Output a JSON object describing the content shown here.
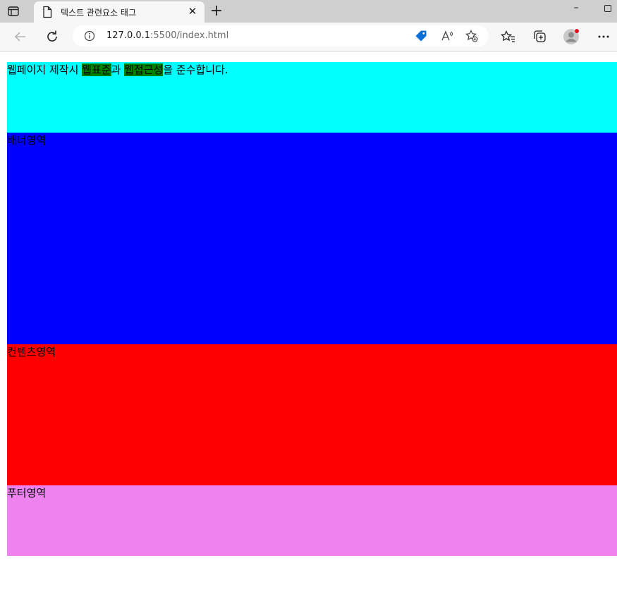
{
  "browser": {
    "tab_title": "텍스트 관련요소 태그",
    "url_host": "127.0.0.1",
    "url_rest": ":5500/index.html"
  },
  "page": {
    "header": {
      "text_1": "웹페이지 제작시 ",
      "highlight_1": "웹표준",
      "text_2": "과 ",
      "highlight_2": "웹접근성",
      "text_3": "을 준수합니다.",
      "bg": "#00ffff"
    },
    "banner": {
      "label": "배너영역",
      "bg": "#0000ff"
    },
    "content": {
      "label": "컨텐츠영역",
      "bg": "#ff0000"
    },
    "footer": {
      "label": "푸터영역",
      "bg": "#ee82ee"
    },
    "highlight_color": "#008000"
  },
  "icons": [
    "tab-actions-icon",
    "page-icon",
    "close-icon",
    "plus-icon",
    "minimize-icon",
    "maximize-icon",
    "back-icon",
    "refresh-icon",
    "info-icon",
    "tag-icon",
    "read-aloud-icon",
    "add-favorite-icon",
    "favorites-icon",
    "collections-icon",
    "profile-avatar",
    "more-icon"
  ]
}
